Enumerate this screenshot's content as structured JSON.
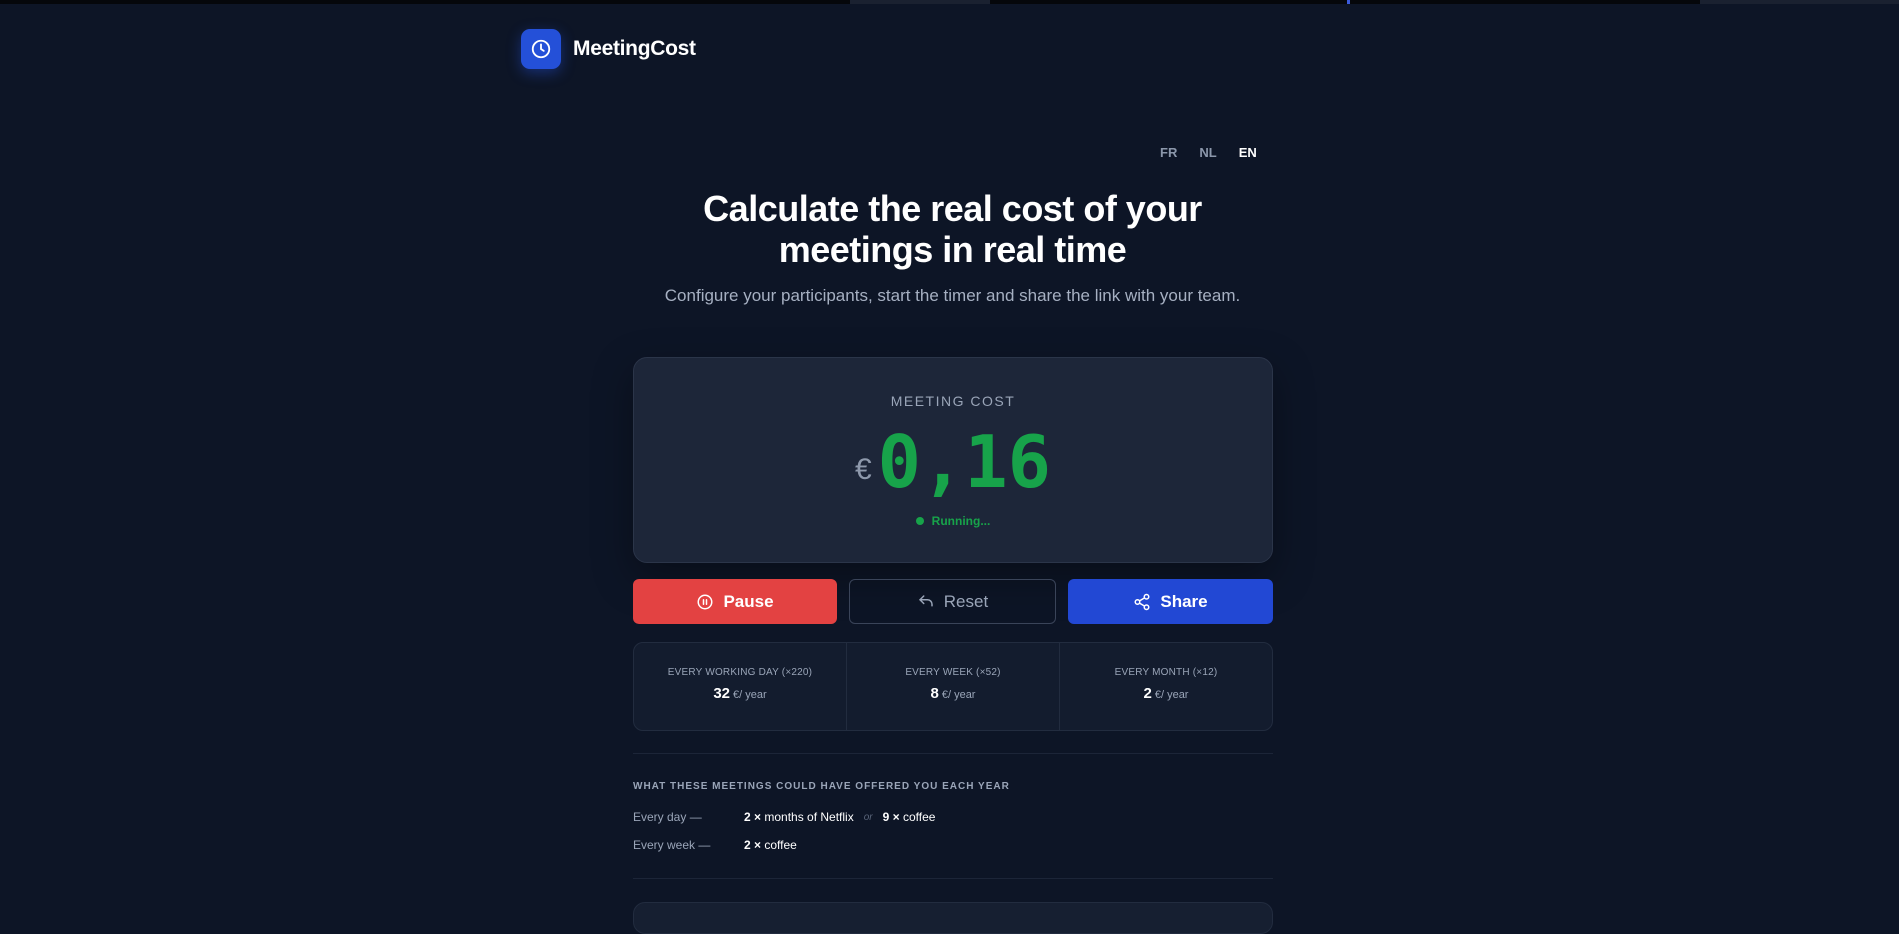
{
  "app": {
    "name": "MeetingCost"
  },
  "languages": [
    {
      "code": "FR",
      "active": false
    },
    {
      "code": "NL",
      "active": false
    },
    {
      "code": "EN",
      "active": true
    }
  ],
  "hero": {
    "title_line1": "Calculate the real cost of your",
    "title_line2": "meetings in real time",
    "subtitle": "Configure your participants, start the timer and share the link with your team."
  },
  "cost": {
    "label": "MEETING COST",
    "currency": "€",
    "value": "0,16",
    "status": "Running..."
  },
  "buttons": {
    "pause": "Pause",
    "reset": "Reset",
    "share": "Share"
  },
  "annual": [
    {
      "label": "EVERY WORKING DAY (×220)",
      "value": "32",
      "unit": "€/ year"
    },
    {
      "label": "EVERY WEEK (×52)",
      "value": "8",
      "unit": "€/ year"
    },
    {
      "label": "EVERY MONTH (×12)",
      "value": "2",
      "unit": "€/ year"
    }
  ],
  "offers": {
    "title": "WHAT THESE MEETINGS COULD HAVE OFFERED YOU EACH YEAR",
    "day": {
      "key": "Every day —",
      "item1_count": "2 ×",
      "item1_text": "months of Netflix",
      "or": "or",
      "item2_count": "9 ×",
      "item2_text": "coffee"
    },
    "week": {
      "key": "Every week —",
      "item1_count": "2 ×",
      "item1_text": "coffee"
    }
  },
  "colors": {
    "background": "#0d1526",
    "accent_blue": "#2248d4",
    "running_green": "#17a34a",
    "pause_red": "#e34242"
  },
  "icons": {
    "logo": "clock-icon",
    "pause": "pause-circle-icon",
    "reset": "undo-icon",
    "share": "share-icon"
  }
}
